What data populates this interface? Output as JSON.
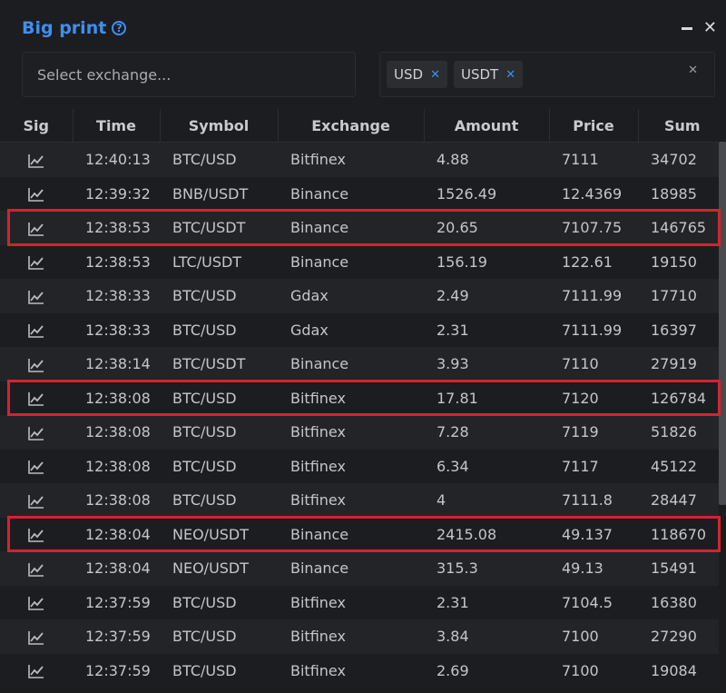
{
  "header": {
    "title": "Big print",
    "help_glyph": "?",
    "minimize_icon": "minimize-icon",
    "close_glyph": "✕"
  },
  "exchange_filter": {
    "placeholder": "Select exchange..."
  },
  "quote_filter": {
    "chips": [
      {
        "label": "USD",
        "remove_glyph": "✕"
      },
      {
        "label": "USDT",
        "remove_glyph": "✕"
      }
    ],
    "clear_glyph": "✕"
  },
  "table": {
    "columns": [
      "Sig",
      "Time",
      "Symbol",
      "Exchange",
      "Amount",
      "Price",
      "Sum"
    ],
    "rows": [
      {
        "time": "12:40:13",
        "symbol": "BTC/USD",
        "exchange": "Bitfinex",
        "amount": "4.88",
        "price": "7111",
        "sum": "34702"
      },
      {
        "time": "12:39:32",
        "symbol": "BNB/USDT",
        "exchange": "Binance",
        "amount": "1526.49",
        "price": "12.4369",
        "sum": "18985"
      },
      {
        "time": "12:38:53",
        "symbol": "BTC/USDT",
        "exchange": "Binance",
        "amount": "20.65",
        "price": "7107.75",
        "sum": "146765"
      },
      {
        "time": "12:38:53",
        "symbol": "LTC/USDT",
        "exchange": "Binance",
        "amount": "156.19",
        "price": "122.61",
        "sum": "19150"
      },
      {
        "time": "12:38:33",
        "symbol": "BTC/USD",
        "exchange": "Gdax",
        "amount": "2.49",
        "price": "7111.99",
        "sum": "17710"
      },
      {
        "time": "12:38:33",
        "symbol": "BTC/USD",
        "exchange": "Gdax",
        "amount": "2.31",
        "price": "7111.99",
        "sum": "16397"
      },
      {
        "time": "12:38:14",
        "symbol": "BTC/USDT",
        "exchange": "Binance",
        "amount": "3.93",
        "price": "7110",
        "sum": "27919"
      },
      {
        "time": "12:38:08",
        "symbol": "BTC/USD",
        "exchange": "Bitfinex",
        "amount": "17.81",
        "price": "7120",
        "sum": "126784"
      },
      {
        "time": "12:38:08",
        "symbol": "BTC/USD",
        "exchange": "Bitfinex",
        "amount": "7.28",
        "price": "7119",
        "sum": "51826"
      },
      {
        "time": "12:38:08",
        "symbol": "BTC/USD",
        "exchange": "Bitfinex",
        "amount": "6.34",
        "price": "7117",
        "sum": "45122"
      },
      {
        "time": "12:38:08",
        "symbol": "BTC/USD",
        "exchange": "Bitfinex",
        "amount": "4",
        "price": "7111.8",
        "sum": "28447"
      },
      {
        "time": "12:38:04",
        "symbol": "NEO/USDT",
        "exchange": "Binance",
        "amount": "2415.08",
        "price": "49.137",
        "sum": "118670"
      },
      {
        "time": "12:38:04",
        "symbol": "NEO/USDT",
        "exchange": "Binance",
        "amount": "315.3",
        "price": "49.13",
        "sum": "15491"
      },
      {
        "time": "12:37:59",
        "symbol": "BTC/USD",
        "exchange": "Bitfinex",
        "amount": "2.31",
        "price": "7104.5",
        "sum": "16380"
      },
      {
        "time": "12:37:59",
        "symbol": "BTC/USD",
        "exchange": "Bitfinex",
        "amount": "3.84",
        "price": "7100",
        "sum": "27290"
      },
      {
        "time": "12:37:59",
        "symbol": "BTC/USD",
        "exchange": "Bitfinex",
        "amount": "2.69",
        "price": "7100",
        "sum": "19084"
      }
    ]
  },
  "colors": {
    "accent": "#3f8ff0",
    "highlight": "#d62230"
  },
  "highlighted_rows": [
    2,
    7,
    11
  ]
}
